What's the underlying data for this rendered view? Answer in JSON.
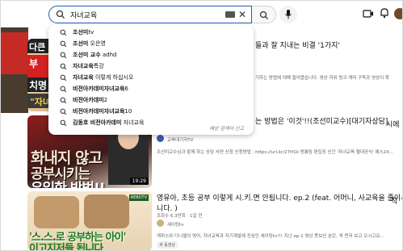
{
  "search": {
    "query": "자녀교육"
  },
  "suggestions": [
    {
      "bold": "조선미",
      "rest": "tv"
    },
    {
      "bold": "조선미",
      "rest": " 오은영"
    },
    {
      "bold": "조선미 교수",
      "rest": " adhd"
    },
    {
      "bold": "자녀교육",
      "rest": "특강"
    },
    {
      "bold": "자녀교육",
      "rest": " 이렇게 하십시오"
    },
    {
      "bold": "비전아카데미자녀교육",
      "rest": "6"
    },
    {
      "bold": "비전아카데미",
      "rest": "2"
    },
    {
      "bold": "비전아카데미자녀교육",
      "rest": "10"
    },
    {
      "bold": "김동호 비전아카데미",
      "rest": " 자녀교육"
    }
  ],
  "dropdown_footer": "예상 검색어 신고",
  "left_partial": {
    "top": "다큰",
    "red": "부",
    "dark": "치명",
    "yellow": "\"자"
  },
  "videos": [
    {
      "title_partial": "들과 잘 지내는 비결 '1가지'",
      "meta_partial": "기하는 방법에 대해 들어봅습니다. 영상 하위 링크 캐러 구독과 영상이 확",
      "thumb_top": "다큰",
      "thumb_red": "부",
      "thumb_dark": "치명",
      "thumb_yellow": "\"자녀"
    },
    {
      "title_partial": "는 방법은 '이것'!!(조선미교수)[대기자상담]",
      "title_side": "시에",
      "channel": "교육대기자TV",
      "meta": "조선미교수님과 함께 하는 상담 사연 신청 신청방법 : https://url.kr/27tf1k 방통팀 편집장 신간 '자녀교육 혈대공식' 예스24...",
      "thumb_line1": "화내지 않고",
      "thumb_line2": "공부시키는",
      "thumb_line3": "유일한 방법!!",
      "duration": "19:29"
    },
    {
      "title": "영유아, 초등 공부 이렇게 시.키.면 안됩니다. ep.2 (feat. 어머니, 사교육을 줄이세야",
      "title2": "니다. )",
      "title_side": "직 ",
      "views": "조회수 6.3만회 · 1일 전",
      "channel": "세이팅tv",
      "meta": "캐피스와 디니엘의 영어, 자녀교육과 자기계발에 진심인 세이팅tv!!! 지난 ep.1 영상 못보신 분은, 꼭 먼저 보고 오시고요...",
      "tag": "새 동영상",
      "thumb_badge": "REBOTV",
      "thumb_line1": "'스.스.로 공부하는 아이'",
      "thumb_line2": "이고지저들 됩니다"
    }
  ],
  "colors": {
    "search_border": "#1c62b9",
    "thumb2_accent": "#8f1d1d",
    "thumb3_text": "#1a7a1a"
  },
  "icons": [
    "search-icon",
    "keyboard-icon",
    "close-icon",
    "mic-icon",
    "create-icon",
    "bell-icon"
  ]
}
